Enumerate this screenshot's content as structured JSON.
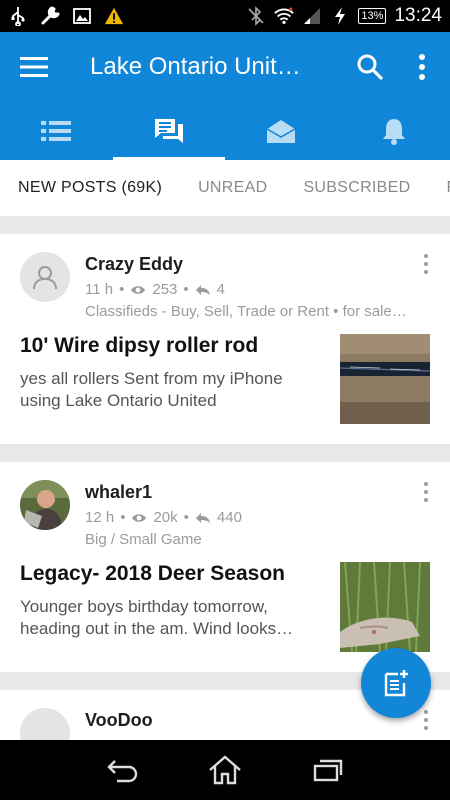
{
  "status_bar": {
    "time": "13:24",
    "battery": "13%",
    "icons": [
      "usb-icon",
      "wrench-icon",
      "image-icon",
      "warning-icon",
      "bluetooth-off-icon",
      "wifi-icon",
      "signal-icon",
      "charging-icon",
      "battery-icon"
    ]
  },
  "app_bar": {
    "title": "Lake Ontario Unit…",
    "icons": [
      "menu-icon",
      "search-icon",
      "overflow-icon"
    ]
  },
  "nav_tabs": [
    {
      "icon": "list-icon",
      "active": false
    },
    {
      "icon": "chat-icon",
      "active": true
    },
    {
      "icon": "inbox-icon",
      "active": false
    },
    {
      "icon": "bell-icon",
      "active": false
    }
  ],
  "sub_tabs": [
    "NEW POSTS (69K)",
    "UNREAD",
    "SUBSCRIBED",
    "F"
  ],
  "threads": [
    {
      "author": "Crazy Eddy",
      "time": "11 h",
      "views": "253",
      "replies": "4",
      "category": "Classifieds - Buy, Sell, Trade or Rent • for sale…",
      "title": "10' Wire dipsy roller rod",
      "excerpt": "yes all rollers Sent from my iPhone using Lake Ontario United"
    },
    {
      "author": "whaler1",
      "time": "12 h",
      "views": "20k",
      "replies": "440",
      "category": "Big / Small Game",
      "title": "Legacy- 2018 Deer Season",
      "excerpt": "Younger boys birthday tomorrow, heading out in the am. Wind looks…"
    },
    {
      "author": "VooDoo",
      "time": "",
      "views": "",
      "replies": "",
      "category": "",
      "title": "",
      "excerpt": ""
    }
  ],
  "colors": {
    "primary": "#0f86d7",
    "fab": "#1287d8",
    "meta_text": "#9b9b9b"
  },
  "system_nav": [
    "back-icon",
    "home-icon",
    "recents-icon"
  ]
}
